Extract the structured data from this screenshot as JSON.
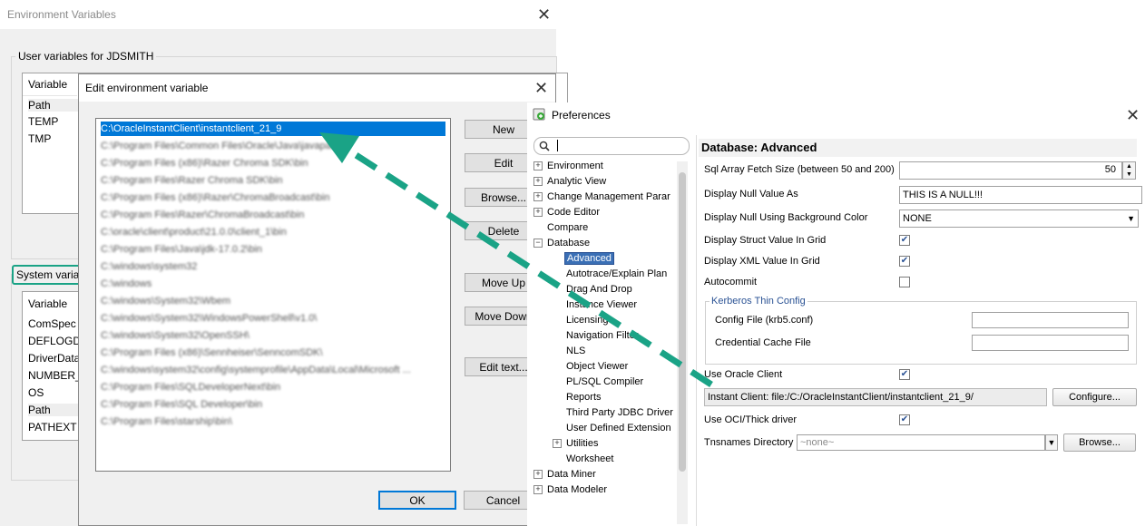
{
  "env_window": {
    "title": "Environment Variables",
    "user_group_label": "User variables for JDSMITH",
    "user_header": "Variable",
    "user_vars": [
      "Path",
      "TEMP",
      "TMP"
    ],
    "system_group_label": "System varia",
    "system_header": "Variable",
    "system_vars": [
      "ComSpec",
      "DEFLOGDI",
      "DriverData",
      "NUMBER_",
      "OS",
      "Path",
      "PATHEXT"
    ]
  },
  "edit_dialog": {
    "title": "Edit environment variable",
    "paths": [
      "C:\\OracleInstantClient\\instantclient_21_9",
      "C:\\Program Files\\Common Files\\Oracle\\Java\\javapath",
      "C:\\Program Files (x86)\\Razer Chroma SDK\\bin",
      "C:\\Program Files\\Razer Chroma SDK\\bin",
      "C:\\Program Files (x86)\\Razer\\ChromaBroadcast\\bin",
      "C:\\Program Files\\Razer\\ChromaBroadcast\\bin",
      "C:\\oracle\\client\\product\\21.0.0\\client_1\\bin",
      "C:\\Program Files\\Java\\jdk-17.0.2\\bin",
      "C:\\windows\\system32",
      "C:\\windows",
      "C:\\windows\\System32\\Wbem",
      "C:\\windows\\System32\\WindowsPowerShell\\v1.0\\",
      "C:\\windows\\System32\\OpenSSH\\",
      "C:\\Program Files (x86)\\Sennheiser\\SenncomSDK\\",
      "C:\\windows\\system32\\config\\systemprofile\\AppData\\Local\\Microsoft ...",
      "C:\\Program Files\\SQLDeveloperNext\\bin",
      "C:\\Program Files\\SQL Developer\\bin",
      "C:\\Program Files\\starship\\bin\\"
    ],
    "buttons": {
      "new": "New",
      "edit": "Edit",
      "browse": "Browse...",
      "delete": "Delete",
      "move_up": "Move Up",
      "move_down": "Move Down",
      "edit_text": "Edit text...",
      "ok": "OK",
      "cancel": "Cancel"
    }
  },
  "preferences": {
    "title": "Preferences",
    "search_value": "",
    "tree": [
      {
        "label": "Environment",
        "expander": "+",
        "level": 0
      },
      {
        "label": "Analytic View",
        "expander": "+",
        "level": 0
      },
      {
        "label": "Change Management Parar",
        "expander": "+",
        "level": 0
      },
      {
        "label": "Code Editor",
        "expander": "+",
        "level": 0
      },
      {
        "label": "Compare",
        "expander": "",
        "level": 0
      },
      {
        "label": "Database",
        "expander": "−",
        "level": 0
      },
      {
        "label": "Advanced",
        "expander": "",
        "level": 1,
        "selected": true
      },
      {
        "label": "Autotrace/Explain Plan",
        "expander": "",
        "level": 1
      },
      {
        "label": "Drag And Drop",
        "expander": "",
        "level": 1
      },
      {
        "label": "Instance Viewer",
        "expander": "",
        "level": 1
      },
      {
        "label": "Licensing",
        "expander": "",
        "level": 1
      },
      {
        "label": "Navigation Filter",
        "expander": "",
        "level": 1
      },
      {
        "label": "NLS",
        "expander": "",
        "level": 1
      },
      {
        "label": "Object Viewer",
        "expander": "",
        "level": 1
      },
      {
        "label": "PL/SQL Compiler",
        "expander": "",
        "level": 1
      },
      {
        "label": "Reports",
        "expander": "",
        "level": 1
      },
      {
        "label": "Third Party JDBC Driver",
        "expander": "",
        "level": 1
      },
      {
        "label": "User Defined Extension",
        "expander": "",
        "level": 1
      },
      {
        "label": "Utilities",
        "expander": "+",
        "level": 1
      },
      {
        "label": "Worksheet",
        "expander": "",
        "level": 1
      },
      {
        "label": "Data Miner",
        "expander": "+",
        "level": 0
      },
      {
        "label": "Data Modeler",
        "expander": "+",
        "level": 0
      }
    ],
    "section_title": "Database: Advanced",
    "fields": {
      "fetch_size_label": "Sql Array Fetch Size (between 50 and 200)",
      "fetch_size_value": "50",
      "null_value_label": "Display Null Value As",
      "null_value_value": "THIS IS A NULL!!!",
      "null_bg_label": "Display Null Using Background Color",
      "null_bg_value": "NONE",
      "struct_label": "Display Struct Value In Grid",
      "xml_label": "Display XML Value In Grid",
      "autocommit_label": "Autocommit",
      "kerberos_group": "Kerberos Thin Config",
      "config_file_label": "Config File (krb5.conf)",
      "cred_cache_label": "Credential Cache File",
      "use_oracle_client_label": "Use Oracle Client",
      "instant_client_text": "Instant Client: file:/C:/OracleInstantClient/instantclient_21_9/",
      "configure_label": "Configure...",
      "oci_label": "Use OCI/Thick driver",
      "tns_label": "Tnsnames Directory",
      "tns_value": "~none~",
      "browse_label": "Browse..."
    },
    "checks": {
      "struct": true,
      "xml": true,
      "autocommit": false,
      "use_oracle_client": true,
      "oci": true
    }
  },
  "colors": {
    "annotation": "#1aa386",
    "selection": "#0078d7"
  }
}
